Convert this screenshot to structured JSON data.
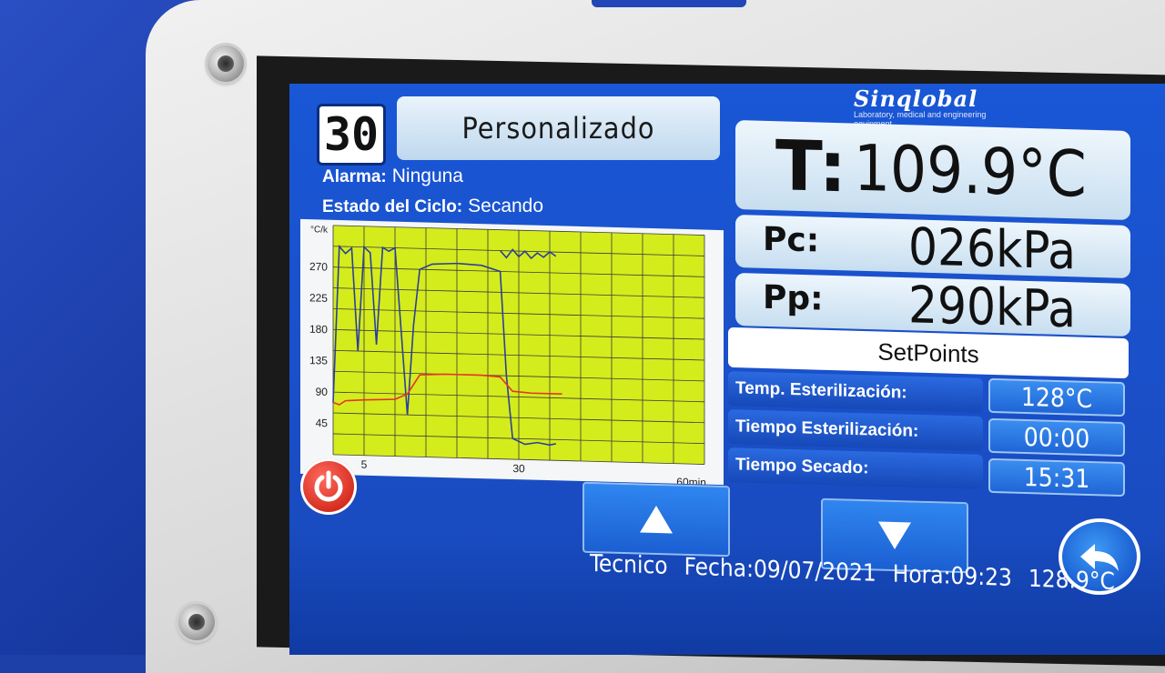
{
  "header": {
    "cycle_number": "30",
    "program_name": "Personalizado",
    "alarm_label": "Alarma:",
    "alarm_value": "Ninguna",
    "cycle_state_label": "Estado del Ciclo:",
    "cycle_state_value": "Secando"
  },
  "brand": {
    "name": "Sinqlobal",
    "tagline": "Laboratory, medical and engineering equipment"
  },
  "readings": {
    "temperature_label": "T:",
    "temperature_value": "109.9°C",
    "chamber_pressure_label": "Pc:",
    "chamber_pressure_value": "026kPa",
    "jacket_pressure_label": "Pp:",
    "jacket_pressure_value": "290kPa"
  },
  "setpoints": {
    "title": "SetPoints",
    "items": [
      {
        "label": "Temp. Esterilización:",
        "value": "128°C"
      },
      {
        "label": "Tiempo Esterilización:",
        "value": "00:00"
      },
      {
        "label": "Tiempo Secado:",
        "value": "15:31"
      }
    ]
  },
  "footer": {
    "user": "Tecnico",
    "date": "Fecha:09/07/2021",
    "time": "Hora:09:23",
    "temperature": "128.9°C"
  },
  "icons": {
    "power": "power-icon",
    "up": "arrow-up-icon",
    "down": "arrow-down-icon",
    "back": "back-arrow-icon"
  },
  "colors": {
    "screen_blue": "#1a4fc8",
    "chart_bg": "#d4ec1c",
    "temperature_series": "#2c3f9c",
    "pressure_series": "#e5342a",
    "power_button": "#d62f22"
  },
  "chart_data": {
    "type": "line",
    "yunit": "°C/k",
    "yticks": [
      45,
      90,
      135,
      180,
      225,
      270
    ],
    "xticks": [
      5,
      30
    ],
    "xend_label": "60min",
    "xlim": [
      0,
      60
    ],
    "ylim": [
      0,
      330
    ],
    "grid": true,
    "series": [
      {
        "color": "#2c3f9c",
        "points": [
          [
            0,
            75
          ],
          [
            1,
            300
          ],
          [
            2,
            290
          ],
          [
            3,
            298
          ],
          [
            4,
            150
          ],
          [
            5,
            300
          ],
          [
            6,
            292
          ],
          [
            7,
            160
          ],
          [
            8,
            300
          ],
          [
            9,
            295
          ],
          [
            10,
            300
          ],
          [
            11,
            180
          ],
          [
            12,
            60
          ],
          [
            13,
            190
          ],
          [
            14,
            270
          ],
          [
            16,
            278
          ],
          [
            20,
            280
          ],
          [
            24,
            278
          ],
          [
            27,
            270
          ],
          [
            28,
            120
          ],
          [
            29,
            30
          ],
          [
            31,
            22
          ],
          [
            33,
            25
          ],
          [
            35,
            22
          ],
          [
            36,
            24
          ]
        ]
      },
      {
        "color": "#e5342a",
        "points": [
          [
            0,
            75
          ],
          [
            1,
            72
          ],
          [
            2,
            78
          ],
          [
            5,
            80
          ],
          [
            10,
            82
          ],
          [
            12,
            90
          ],
          [
            14,
            118
          ],
          [
            18,
            120
          ],
          [
            24,
            120
          ],
          [
            27,
            118
          ],
          [
            29,
            98
          ],
          [
            32,
            96
          ],
          [
            37,
            96
          ]
        ]
      },
      {
        "color": "#2c3f9c",
        "points": [
          [
            27,
            300
          ],
          [
            28,
            290
          ],
          [
            29,
            302
          ],
          [
            30,
            292
          ],
          [
            31,
            300
          ],
          [
            32,
            290
          ],
          [
            33,
            298
          ],
          [
            34,
            292
          ],
          [
            35,
            300
          ],
          [
            36,
            294
          ]
        ]
      }
    ]
  }
}
